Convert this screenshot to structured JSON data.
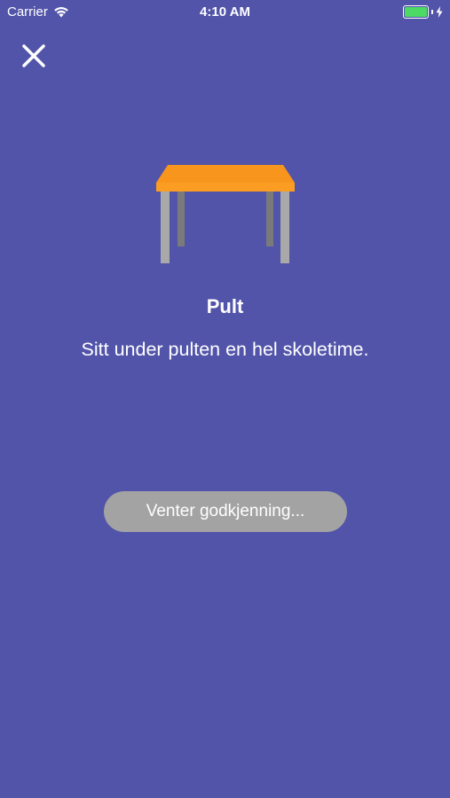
{
  "status_bar": {
    "carrier": "Carrier",
    "time": "4:10 AM",
    "battery_color": "#4cd964",
    "wifi_icon": "wifi-icon",
    "battery_icon": "battery-icon",
    "charging_icon": "bolt-icon"
  },
  "header": {
    "close_icon": "close-icon"
  },
  "challenge": {
    "illustration": "desk-icon",
    "title": "Pult",
    "description": "Sitt under pulten en hel skoletime.",
    "status_label": "Venter godkjenning..."
  },
  "colors": {
    "background": "#5254aa",
    "desk_top": "#f7951d",
    "desk_legs": "#a9a9a9",
    "status_pill": "#a3a3a3"
  }
}
